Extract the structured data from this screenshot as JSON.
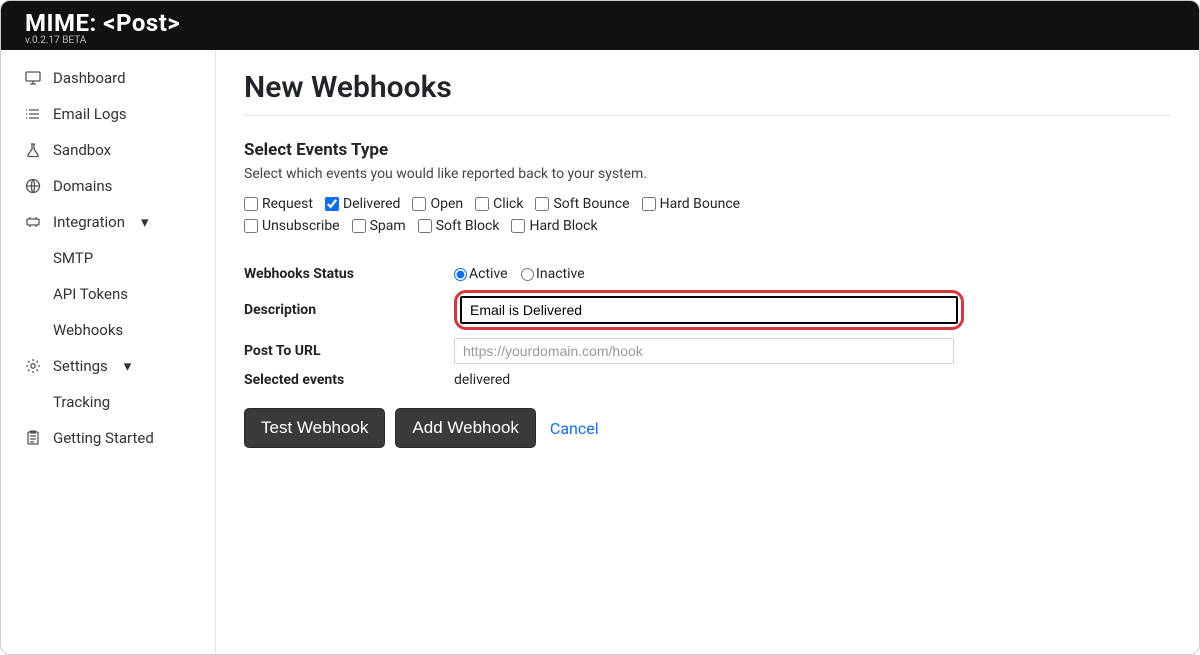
{
  "header": {
    "brand": "MIME: <Post>",
    "version": "v.0.2.17 BETA"
  },
  "sidebar": {
    "items": [
      {
        "label": "Dashboard",
        "icon": "monitor"
      },
      {
        "label": "Email Logs",
        "icon": "list"
      },
      {
        "label": "Sandbox",
        "icon": "flask"
      },
      {
        "label": "Domains",
        "icon": "globe"
      },
      {
        "label": "Integration",
        "icon": "plug",
        "expandable": true,
        "children": [
          {
            "label": "SMTP"
          },
          {
            "label": "API Tokens"
          },
          {
            "label": "Webhooks"
          }
        ]
      },
      {
        "label": "Settings",
        "icon": "gear",
        "expandable": true,
        "children": [
          {
            "label": "Tracking"
          }
        ]
      },
      {
        "label": "Getting Started",
        "icon": "clipboard"
      }
    ]
  },
  "page": {
    "title": "New Webhooks",
    "events_title": "Select Events Type",
    "events_desc": "Select which events you would like reported back to your system.",
    "events": [
      {
        "label": "Request",
        "checked": false
      },
      {
        "label": "Delivered",
        "checked": true
      },
      {
        "label": "Open",
        "checked": false
      },
      {
        "label": "Click",
        "checked": false
      },
      {
        "label": "Soft Bounce",
        "checked": false
      },
      {
        "label": "Hard Bounce",
        "checked": false
      },
      {
        "label": "Unsubscribe",
        "checked": false
      },
      {
        "label": "Spam",
        "checked": false
      },
      {
        "label": "Soft Block",
        "checked": false
      },
      {
        "label": "Hard Block",
        "checked": false
      }
    ],
    "form": {
      "status_label": "Webhooks Status",
      "status_active": "Active",
      "status_inactive": "Inactive",
      "status_value": "Active",
      "description_label": "Description",
      "description_value": "Email is Delivered",
      "url_label": "Post To URL",
      "url_placeholder": "https://yourdomain.com/hook",
      "url_value": "",
      "selected_label": "Selected events",
      "selected_value": "delivered"
    },
    "actions": {
      "test": "Test Webhook",
      "add": "Add Webhook",
      "cancel": "Cancel"
    }
  }
}
